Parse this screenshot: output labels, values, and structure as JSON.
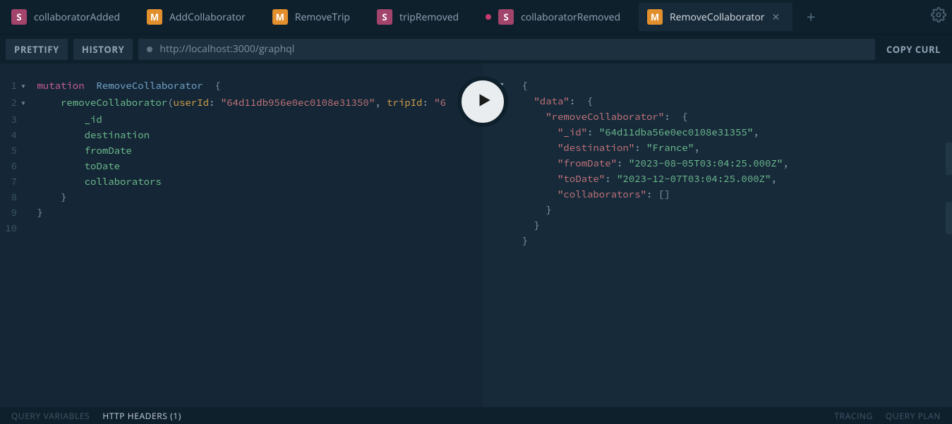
{
  "tabs": [
    {
      "badge": "S",
      "badgeClass": "badge-s",
      "label": "collaboratorAdded",
      "dot": false,
      "close": false
    },
    {
      "badge": "M",
      "badgeClass": "badge-m",
      "label": "AddCollaborator",
      "dot": false,
      "close": false
    },
    {
      "badge": "M",
      "badgeClass": "badge-m",
      "label": "RemoveTrip",
      "dot": false,
      "close": false
    },
    {
      "badge": "S",
      "badgeClass": "badge-s",
      "label": "tripRemoved",
      "dot": false,
      "close": false
    },
    {
      "badge": "S",
      "badgeClass": "badge-s",
      "label": "collaboratorRemoved",
      "dot": true,
      "close": false
    },
    {
      "badge": "M",
      "badgeClass": "badge-m",
      "label": "RemoveCollaborator",
      "dot": false,
      "close": true,
      "active": true
    }
  ],
  "plus": "+",
  "toolbar": {
    "prettify": "PRETTIFY",
    "history": "HISTORY",
    "url": "http://localhost:3000/graphql",
    "copyCurl": "COPY CURL"
  },
  "editor": {
    "lines": [
      {
        "n": "1",
        "fold": "▼",
        "html": "<span class='tok-key'>mutation</span>  <span class='tok-name'>RemoveCollaborator</span>  <span class='tok-punc'>{</span>"
      },
      {
        "n": "2",
        "fold": "▼",
        "html": "    <span class='tok-field'>removeCollaborator</span><span class='tok-punc'>(</span><span class='tok-arg'>userId</span><span class='tok-punc'>:</span> <span class='tok-str'>\"64d11db956e0ec0108e31350\"</span><span class='tok-punc'>,</span> <span class='tok-arg'>tripId</span><span class='tok-punc'>:</span> <span class='tok-str'>\"6</span>"
      },
      {
        "n": "3",
        "fold": "",
        "html": "        <span class='tok-field'>_id</span>"
      },
      {
        "n": "4",
        "fold": "",
        "html": "        <span class='tok-field'>destination</span>"
      },
      {
        "n": "5",
        "fold": "",
        "html": "        <span class='tok-field'>fromDate</span>"
      },
      {
        "n": "6",
        "fold": "",
        "html": "        <span class='tok-field'>toDate</span>"
      },
      {
        "n": "7",
        "fold": "",
        "html": "        <span class='tok-field'>collaborators</span>"
      },
      {
        "n": "8",
        "fold": "",
        "html": "    <span class='tok-punc'>}</span>"
      },
      {
        "n": "9",
        "fold": "",
        "html": "<span class='tok-punc'>}</span>"
      },
      {
        "n": "10",
        "fold": "",
        "html": ""
      }
    ]
  },
  "result": {
    "lines": [
      "▼   <span class='res-punc'>{</span>",
      "▼     <span class='res-key'>\"data\"</span><span class='res-punc'>:</span>  <span class='res-punc'>{</span>",
      "▼       <span class='res-key'>\"removeCollaborator\"</span><span class='res-punc'>:</span>  <span class='res-punc'>{</span>",
      "          <span class='res-key'>\"_id\"</span><span class='res-punc'>:</span> <span class='res-str'>\"64d11dba56e0ec0108e31355\"</span><span class='res-punc'>,</span>",
      "          <span class='res-key'>\"destination\"</span><span class='res-punc'>:</span> <span class='res-str'>\"France\"</span><span class='res-punc'>,</span>",
      "          <span class='res-key'>\"fromDate\"</span><span class='res-punc'>:</span> <span class='res-str'>\"2023-08-05T03:04:25.000Z\"</span><span class='res-punc'>,</span>",
      "          <span class='res-key'>\"toDate\"</span><span class='res-punc'>:</span> <span class='res-str'>\"2023-12-07T03:04:25.000Z\"</span><span class='res-punc'>,</span>",
      "          <span class='res-key'>\"collaborators\"</span><span class='res-punc'>:</span> <span class='res-punc'>[]</span>",
      "        <span class='res-punc'>}</span>",
      "      <span class='res-punc'>}</span>",
      "    <span class='res-punc'>}</span>"
    ]
  },
  "footer": {
    "queryVars": "QUERY VARIABLES",
    "httpHeaders": "HTTP HEADERS (1)",
    "tracing": "TRACING",
    "queryPlan": "QUERY PLAN"
  }
}
